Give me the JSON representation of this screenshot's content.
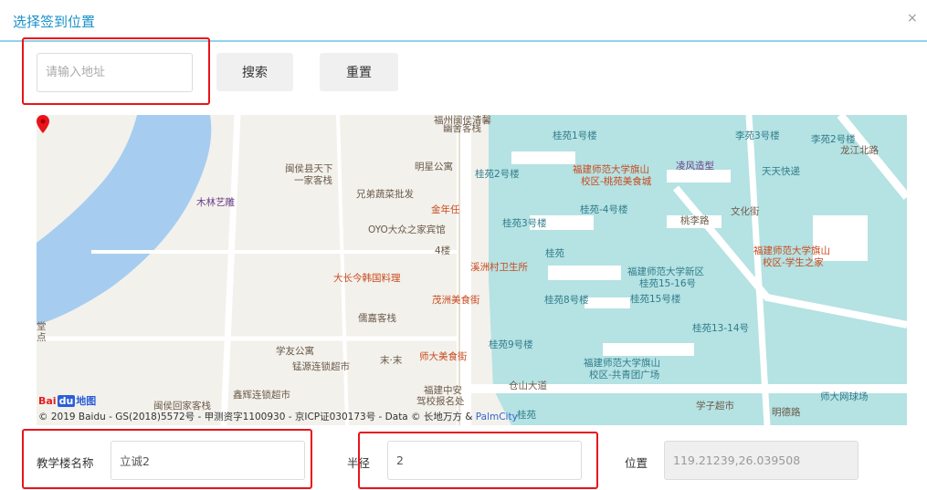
{
  "dialog": {
    "title": "选择签到位置",
    "close_symbol": "×"
  },
  "search": {
    "placeholder": "请输入地址",
    "value": "",
    "search_label": "搜索",
    "reset_label": "重置"
  },
  "map": {
    "labels": [
      {
        "text": "福州闽侯清馨",
        "color": "brown"
      },
      {
        "text": "幽舍客栈",
        "color": "brown"
      },
      {
        "text": "桂苑1号楼",
        "color": "teal"
      },
      {
        "text": "李苑3号楼",
        "color": "teal"
      },
      {
        "text": "李苑2号楼",
        "color": "teal"
      },
      {
        "text": "龙江北路",
        "color": "brown"
      },
      {
        "text": "闽侯县天下",
        "color": "brown"
      },
      {
        "text": "一家客栈",
        "color": "brown"
      },
      {
        "text": "明星公寓",
        "color": "brown"
      },
      {
        "text": "桂苑2号楼",
        "color": "teal"
      },
      {
        "text": "福建师范大学旗山",
        "color": "red"
      },
      {
        "text": "校区-桃苑美食城",
        "color": "red"
      },
      {
        "text": "凌风造型",
        "color": "purple"
      },
      {
        "text": "天天快递",
        "color": "teal"
      },
      {
        "text": "木林艺雕",
        "color": "purple"
      },
      {
        "text": "兄弟蔬菜批发",
        "color": "brown"
      },
      {
        "text": "金年任",
        "color": "red"
      },
      {
        "text": "桂苑-4号楼",
        "color": "teal"
      },
      {
        "text": "桃李路",
        "color": "brown"
      },
      {
        "text": "文化街",
        "color": "brown"
      },
      {
        "text": "桂苑3号楼",
        "color": "teal"
      },
      {
        "text": "OYO大众之家宾馆",
        "color": "brown"
      },
      {
        "text": "4楼",
        "color": "brown"
      },
      {
        "text": "福建师范大学旗山",
        "color": "red"
      },
      {
        "text": "校区-学生之家",
        "color": "red"
      },
      {
        "text": "桂苑",
        "color": "teal"
      },
      {
        "text": "溪洲村卫生所",
        "color": "red"
      },
      {
        "text": "大长今韩国料理",
        "color": "red"
      },
      {
        "text": "福建师范大学新区",
        "color": "teal"
      },
      {
        "text": "桂苑15-16号",
        "color": "teal"
      },
      {
        "text": "茂洲美食街",
        "color": "red"
      },
      {
        "text": "桂苑8号楼",
        "color": "teal"
      },
      {
        "text": "桂苑15号楼",
        "color": "teal"
      },
      {
        "text": "儒嘉客栈",
        "color": "brown"
      },
      {
        "text": "桂苑13-14号",
        "color": "teal"
      },
      {
        "text": "堂",
        "color": "brown"
      },
      {
        "text": "点",
        "color": "brown"
      },
      {
        "text": "学友公寓",
        "color": "brown"
      },
      {
        "text": "末·末",
        "color": "brown"
      },
      {
        "text": "师大美食街",
        "color": "red"
      },
      {
        "text": "桂苑9号楼",
        "color": "teal"
      },
      {
        "text": "锰源连锁超市",
        "color": "brown"
      },
      {
        "text": "福建师范大学旗山",
        "color": "teal"
      },
      {
        "text": "校区-共青团广场",
        "color": "teal"
      },
      {
        "text": "福建中安",
        "color": "brown"
      },
      {
        "text": "驾校报名处",
        "color": "brown"
      },
      {
        "text": "仓山大道",
        "color": "brown"
      },
      {
        "text": "师大网球场",
        "color": "teal"
      },
      {
        "text": "鑫辉连锁超市",
        "color": "brown"
      },
      {
        "text": "学子超市",
        "color": "brown"
      },
      {
        "text": "闽侯回家客栈",
        "color": "brown"
      },
      {
        "text": "明德路",
        "color": "brown"
      },
      {
        "text": "桂苑",
        "color": "teal"
      }
    ],
    "logo": {
      "bai": "Bai",
      "du": "du",
      "ditu": "地图"
    },
    "copyright": "© 2019 Baidu - GS(2018)5572号 - 甲测资字1100930 - 京ICP证030173号 - Data © 长地万方 & ",
    "copyright_link": "PalmCity",
    "marker_icon": "location-pin-icon"
  },
  "form": {
    "building_label": "教学楼名称",
    "building_value": "立诚2",
    "radius_label": "半径",
    "radius_value": "2",
    "position_label": "位置",
    "position_value": "119.21239,26.039508"
  },
  "colors": {
    "accent": "#1890c8",
    "highlight_frame": "#e8141a",
    "map_water": "#a6cdef",
    "campus_area": "#b5e2e3"
  }
}
